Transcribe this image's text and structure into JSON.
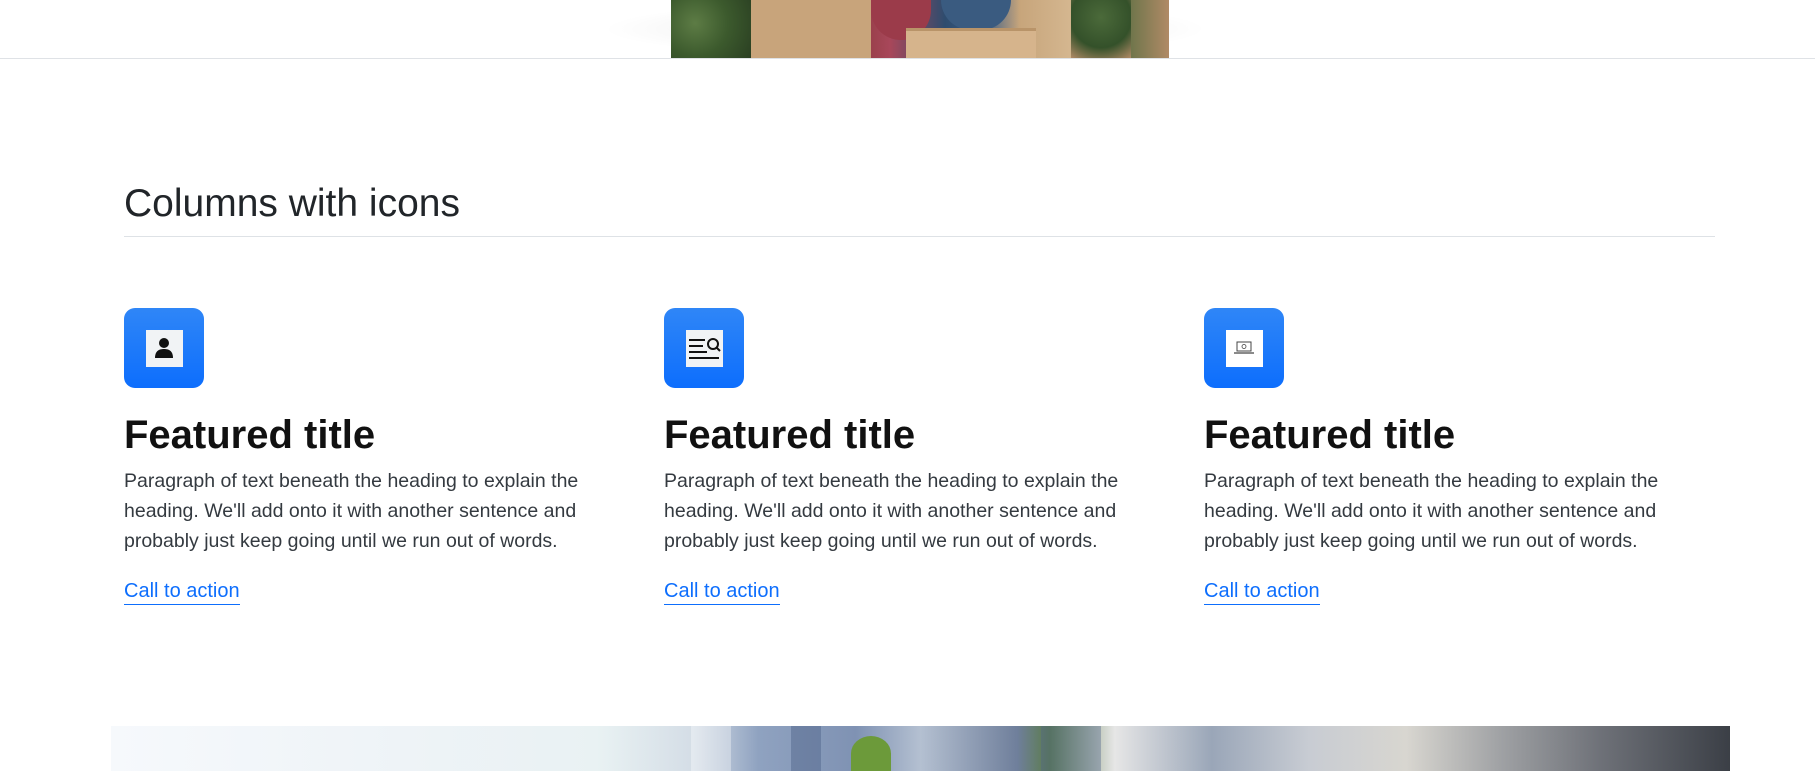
{
  "section": {
    "title": "Columns with icons"
  },
  "features": [
    {
      "icon": "person-icon",
      "title": "Featured title",
      "text": "Paragraph of text beneath the heading to explain the heading. We'll add onto it with another sentence and probably just keep going until we run out of words.",
      "link": "Call to action"
    },
    {
      "icon": "search-document-icon",
      "title": "Featured title",
      "text": "Paragraph of text beneath the heading to explain the heading. We'll add onto it with another sentence and probably just keep going until we run out of words.",
      "link": "Call to action"
    },
    {
      "icon": "laptop-icon",
      "title": "Featured title",
      "text": "Paragraph of text beneath the heading to explain the heading. We'll add onto it with another sentence and probably just keep going until we run out of words.",
      "link": "Call to action"
    }
  ],
  "colors": {
    "accent": "#0d6efd",
    "icon_box": "#1a75fb",
    "heading": "#212529",
    "body_text": "#343a40",
    "rule": "#dee2e6"
  }
}
